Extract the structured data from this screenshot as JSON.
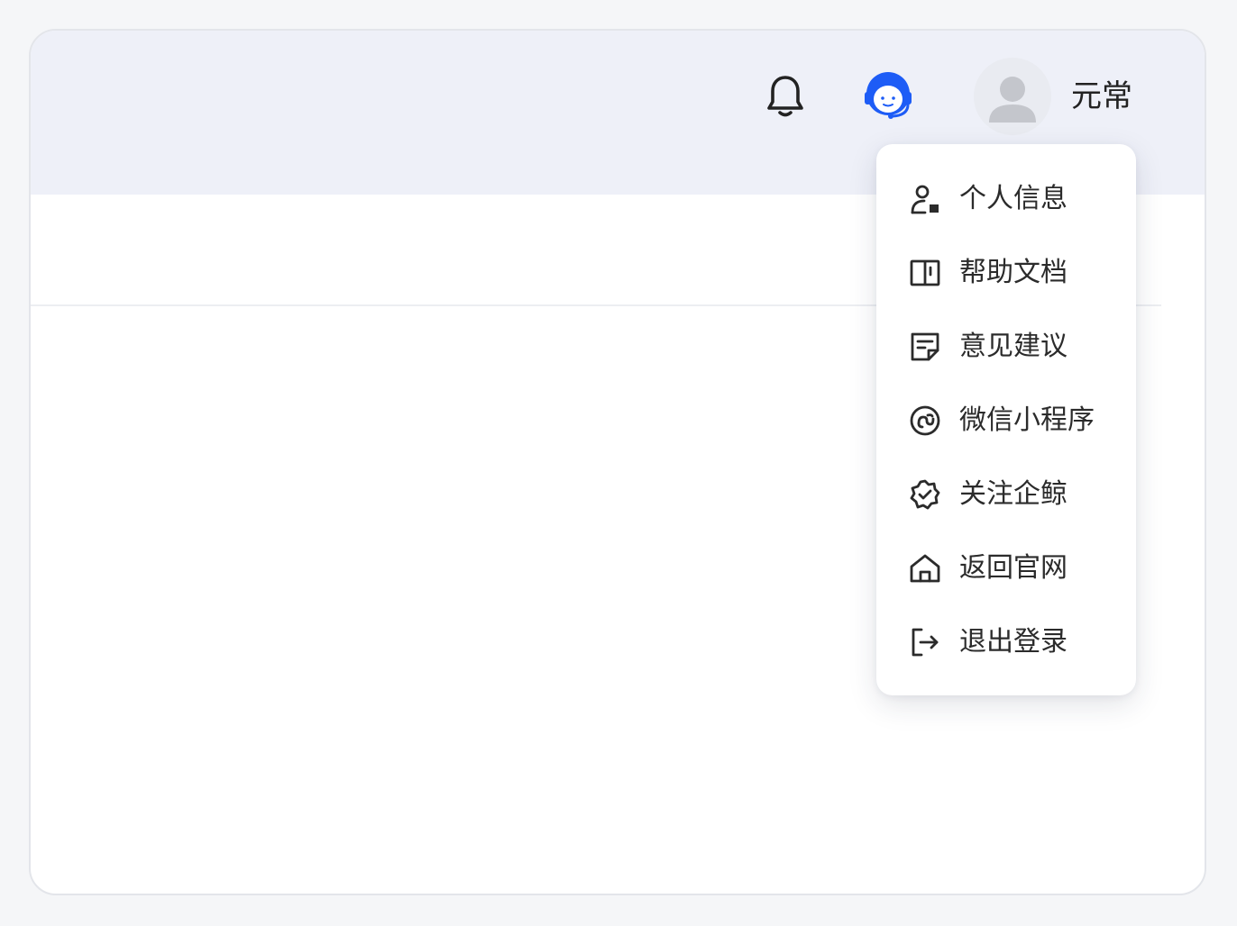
{
  "header": {
    "username": "元常"
  },
  "icons": {
    "notification": "bell-icon",
    "support": "customer-service-icon",
    "avatar": "default-user-avatar"
  },
  "colors": {
    "support_blue": "#1d5cf6",
    "menu_text": "#2b2b2b",
    "header_bg": "#eef0f8"
  },
  "dropdown": {
    "items": [
      {
        "label": "个人信息",
        "icon": "user-profile-icon"
      },
      {
        "label": "帮助文档",
        "icon": "book-icon"
      },
      {
        "label": "意见建议",
        "icon": "feedback-icon"
      },
      {
        "label": "微信小程序",
        "icon": "mini-program-icon"
      },
      {
        "label": "关注企鲸",
        "icon": "badge-check-icon"
      },
      {
        "label": "返回官网",
        "icon": "home-icon"
      },
      {
        "label": "退出登录",
        "icon": "logout-icon"
      }
    ]
  }
}
